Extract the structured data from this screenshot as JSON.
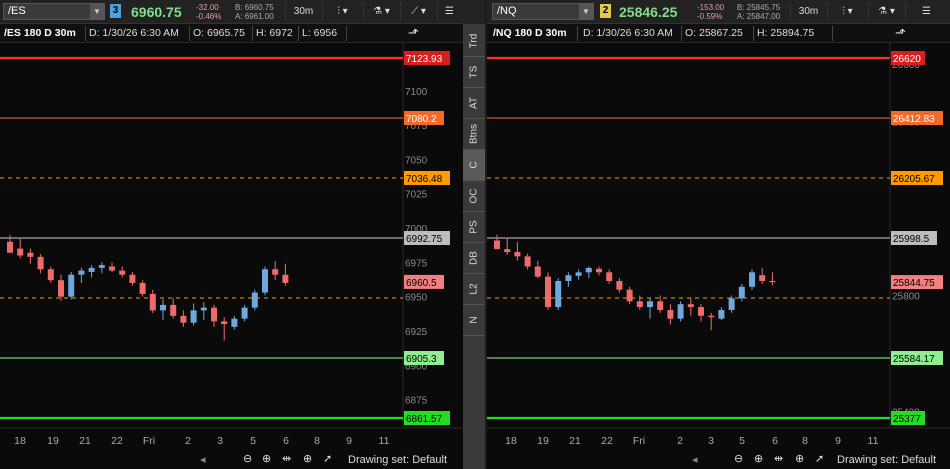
{
  "sidetabs": [
    "Trd",
    "TS",
    "AT",
    "Btns",
    "C",
    "OC",
    "PS",
    "DB",
    "L2",
    "N"
  ],
  "sidetab_active": 4,
  "panels": [
    {
      "symbol": "/ES",
      "link_num": "3",
      "link_color": "#4aa3df",
      "last": "6960.75",
      "chg": "-32.00",
      "chg_pct": "-0.46%",
      "bid": "B: 6960.75",
      "ask": "A: 6961.00",
      "period": "30m",
      "info": {
        "title": "/ES 180 D 30m",
        "d": "D: 1/30/26 6:30 AM",
        "o": "O: 6965.75",
        "h": "H: 6972",
        "l": "L: 6956"
      },
      "drawing_set": "Drawing set: Default",
      "x_labels": [
        "18",
        "19",
        "21",
        "22",
        "Fri",
        "2",
        "3",
        "5",
        "6",
        "8",
        "9",
        "11"
      ],
      "y_labels": [
        {
          "text": "7100",
          "v": 7100
        },
        {
          "text": "7075",
          "v": 7075
        },
        {
          "text": "7050",
          "v": 7050
        },
        {
          "text": "7025",
          "v": 7025
        },
        {
          "text": "7000",
          "v": 7000
        },
        {
          "text": "6975",
          "v": 6975
        },
        {
          "text": "6950",
          "v": 6950
        },
        {
          "text": "6925",
          "v": 6925
        },
        {
          "text": "6900",
          "v": 6900
        },
        {
          "text": "6875",
          "v": 6875
        }
      ],
      "level_lines": [
        {
          "value": 7123.93,
          "label": "7123.93",
          "color": "#ff2a2a",
          "bg": "#d62020",
          "fg": "#ffffff",
          "dash": false,
          "w": 2.2
        },
        {
          "value": 7080.2,
          "label": "7080.2",
          "color": "#ff6a2a",
          "bg": "#f26a2a",
          "fg": "#ffffff",
          "dash": false,
          "w": 1
        },
        {
          "value": 7036.48,
          "label": "7036.48",
          "color": "#ff9a00",
          "bg": "#ff9a00",
          "fg": "#000000",
          "dash": true,
          "w": 1
        },
        {
          "value": 6992.75,
          "label": "6992.75",
          "color": "#cfcfcf",
          "bg": "#bdbdbd",
          "fg": "#000000",
          "dash": false,
          "w": 1
        },
        {
          "value": 6949.02,
          "label": "",
          "color": "#ff9a00",
          "bg": "#ff9a00",
          "fg": "#000000",
          "dash": true,
          "w": 1
        },
        {
          "value": 6905.3,
          "label": "6905.3",
          "color": "#90ff90",
          "bg": "#90ee90",
          "fg": "#000000",
          "dash": false,
          "w": 1
        },
        {
          "value": 6861.57,
          "label": "6861.57",
          "color": "#22dd22",
          "bg": "#22dd22",
          "fg": "#000000",
          "dash": false,
          "w": 2.2
        }
      ],
      "current_price": {
        "value": 6960.75,
        "label": "6960.5",
        "bg": "#f28080",
        "fg": "#000000"
      },
      "candles": [
        [
          6990,
          6995,
          6985,
          6982
        ],
        [
          6985,
          6993,
          6978,
          6980
        ],
        [
          6982,
          6985,
          6974,
          6979
        ],
        [
          6979,
          6981,
          6967,
          6970
        ],
        [
          6970,
          6972,
          6960,
          6962
        ],
        [
          6962,
          6966,
          6947,
          6950
        ],
        [
          6950,
          6968,
          6948,
          6966
        ],
        [
          6966,
          6971,
          6960,
          6969
        ],
        [
          6968,
          6973,
          6964,
          6971
        ],
        [
          6971,
          6975,
          6967,
          6973
        ],
        [
          6972,
          6975,
          6968,
          6969
        ],
        [
          6969,
          6972,
          6964,
          6966
        ],
        [
          6966,
          6968,
          6958,
          6960
        ],
        [
          6960,
          6962,
          6950,
          6952
        ],
        [
          6952,
          6955,
          6938,
          6940
        ],
        [
          6940,
          6948,
          6933,
          6944
        ],
        [
          6944,
          6949,
          6934,
          6936
        ],
        [
          6936,
          6940,
          6928,
          6931
        ],
        [
          6931,
          6945,
          6929,
          6940
        ],
        [
          6940,
          6946,
          6933,
          6942
        ],
        [
          6942,
          6944,
          6928,
          6932
        ],
        [
          6932,
          6935,
          6918,
          6930
        ],
        [
          6928,
          6936,
          6926,
          6934
        ],
        [
          6934,
          6944,
          6932,
          6942
        ],
        [
          6942,
          6955,
          6940,
          6953
        ],
        [
          6953,
          6972,
          6951,
          6970
        ],
        [
          6970,
          6976,
          6962,
          6966
        ],
        [
          6966,
          6974,
          6958,
          6960
        ]
      ]
    },
    {
      "symbol": "/NQ",
      "link_num": "2",
      "link_color": "#e8c84a",
      "last": "25846.25",
      "chg": "-153.00",
      "chg_pct": "-0.59%",
      "bid": "B: 25845.75",
      "ask": "A: 25847.00",
      "period": "30m",
      "info": {
        "title": "/NQ 180 D 30m",
        "d": "D: 1/30/26 6:30 AM",
        "o": "O: 25867.25",
        "h": "H: 25894.75",
        "l": ""
      },
      "drawing_set": "Drawing set: Default",
      "x_labels": [
        "18",
        "19",
        "21",
        "22",
        "Fri",
        "2",
        "3",
        "5",
        "6",
        "8",
        "9",
        "11"
      ],
      "y_labels": [
        {
          "text": "26600",
          "v": 26600
        },
        {
          "text": "26400",
          "v": 26400
        },
        {
          "text": "25800",
          "v": 25800
        },
        {
          "text": "25400",
          "v": 25400
        }
      ],
      "level_lines": [
        {
          "value": 26620,
          "label": "26620",
          "color": "#ff2a2a",
          "bg": "#d62020",
          "fg": "#ffffff",
          "dash": false,
          "w": 2.2
        },
        {
          "value": 26412.83,
          "label": "26412.83",
          "color": "#ff6a2a",
          "bg": "#f26a2a",
          "fg": "#ffffff",
          "dash": false,
          "w": 1
        },
        {
          "value": 26205.67,
          "label": "26205.67",
          "color": "#ff9a00",
          "bg": "#ff9a00",
          "fg": "#000000",
          "dash": true,
          "w": 1
        },
        {
          "value": 25998.5,
          "label": "25998.5",
          "color": "#cfcfcf",
          "bg": "#bdbdbd",
          "fg": "#000000",
          "dash": false,
          "w": 1
        },
        {
          "value": 25791.33,
          "label": "",
          "color": "#ff9a00",
          "bg": "#ff9a00",
          "fg": "#000000",
          "dash": true,
          "w": 1
        },
        {
          "value": 25584.17,
          "label": "25584.17",
          "color": "#90ff90",
          "bg": "#90ee90",
          "fg": "#000000",
          "dash": false,
          "w": 1
        },
        {
          "value": 25377,
          "label": "25377",
          "color": "#22dd22",
          "bg": "#22dd22",
          "fg": "#000000",
          "dash": false,
          "w": 2.2
        }
      ],
      "current_price": {
        "value": 25846.25,
        "label": "25844.75",
        "bg": "#f28080",
        "fg": "#000000"
      },
      "candles": [
        [
          25990,
          26010,
          25960,
          25960
        ],
        [
          25960,
          26000,
          25940,
          25950
        ],
        [
          25950,
          25985,
          25920,
          25935
        ],
        [
          25935,
          25945,
          25890,
          25900
        ],
        [
          25900,
          25920,
          25860,
          25865
        ],
        [
          25865,
          25880,
          25750,
          25760
        ],
        [
          25760,
          25860,
          25750,
          25850
        ],
        [
          25850,
          25880,
          25830,
          25870
        ],
        [
          25868,
          25890,
          25855,
          25880
        ],
        [
          25880,
          25900,
          25860,
          25895
        ],
        [
          25892,
          25900,
          25870,
          25880
        ],
        [
          25880,
          25890,
          25840,
          25850
        ],
        [
          25850,
          25860,
          25810,
          25820
        ],
        [
          25820,
          25830,
          25770,
          25780
        ],
        [
          25780,
          25800,
          25750,
          25760
        ],
        [
          25760,
          25790,
          25720,
          25780
        ],
        [
          25780,
          25800,
          25740,
          25750
        ],
        [
          25750,
          25770,
          25700,
          25720
        ],
        [
          25720,
          25780,
          25710,
          25770
        ],
        [
          25770,
          25790,
          25730,
          25760
        ],
        [
          25760,
          25770,
          25710,
          25730
        ],
        [
          25730,
          25740,
          25680,
          25725
        ],
        [
          25720,
          25760,
          25715,
          25750
        ],
        [
          25750,
          25800,
          25740,
          25790
        ],
        [
          25790,
          25840,
          25780,
          25830
        ],
        [
          25830,
          25890,
          25820,
          25880
        ],
        [
          25870,
          25895,
          25840,
          25850
        ],
        [
          25850,
          25880,
          25835,
          25846
        ]
      ]
    }
  ]
}
